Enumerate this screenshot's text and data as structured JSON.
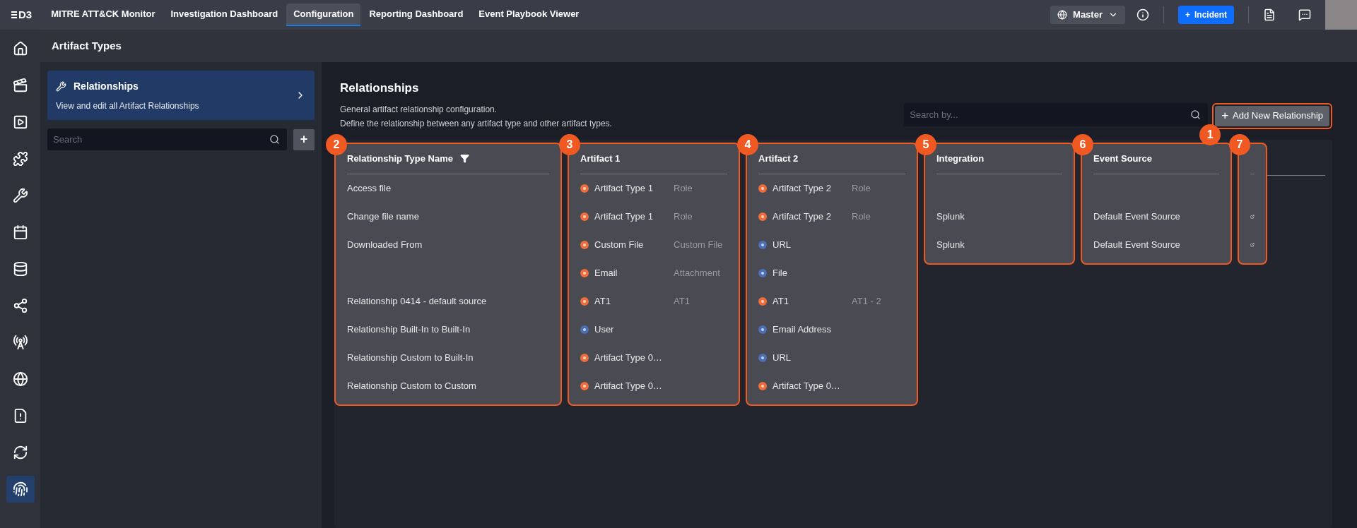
{
  "top_nav": {
    "logo": "D3",
    "tabs": [
      {
        "label": "MITRE ATT&CK Monitor",
        "selected": false
      },
      {
        "label": "Investigation Dashboard",
        "selected": false
      },
      {
        "label": "Configuration",
        "selected": true
      },
      {
        "label": "Reporting Dashboard",
        "selected": false
      },
      {
        "label": "Event Playbook Viewer",
        "selected": false
      }
    ],
    "site": "Master",
    "incident_button": "Incident",
    "incident_plus": "+"
  },
  "nav_rail": [
    {
      "selected": false
    },
    {
      "selected": false
    },
    {
      "selected": false
    },
    {
      "selected": false
    },
    {
      "selected": false
    },
    {
      "selected": false
    },
    {
      "selected": false
    },
    {
      "selected": false
    },
    {
      "selected": false
    },
    {
      "selected": false
    },
    {
      "selected": false
    },
    {
      "selected": false
    },
    {
      "selected": true
    }
  ],
  "page_title": "Artifact Types",
  "side_panel": {
    "card": {
      "title": "Relationships",
      "subtitle": "View and edit all Artifact Relationships"
    },
    "search": {
      "placeholder": "Search"
    },
    "add_button": "+"
  },
  "main": {
    "title": "Relationships",
    "description": [
      "General artifact relationship configuration.",
      "Define the relationship between any artifact type and other artifact types."
    ],
    "search": {
      "placeholder": "Search by..."
    },
    "add_button": {
      "plus": "+",
      "label": "Add New Relationship",
      "highlighted": true,
      "callout": "1"
    },
    "table": {
      "columns": [
        {
          "header": "Relationship Type Name",
          "filter": true,
          "highlighted": true,
          "callout": "2"
        },
        {
          "header": "Artifact 1",
          "highlighted": true,
          "callout": "3"
        },
        {
          "header": "Artifact 2",
          "highlighted": true,
          "callout": "4"
        },
        {
          "header": "Integration",
          "highlighted": true,
          "callout": "5"
        },
        {
          "header": "Event Source",
          "highlighted": true,
          "callout": "6"
        },
        {
          "highlighted": true,
          "callout": "7"
        }
      ],
      "rows": [
        {
          "name": "Access file",
          "artifact_1": {
            "name": "Artifact Type 1",
            "role": "Role",
            "color": "#ef6c3c"
          },
          "artifact_2": {
            "name": "Artifact Type 2",
            "role": "Role",
            "color": "#ef6c3c"
          }
        },
        {
          "name": "Change file name",
          "artifact_1": {
            "name": "Artifact Type 1",
            "role": "Role",
            "color": "#ef6c3c"
          },
          "artifact_2": {
            "name": "Artifact Type 2",
            "role": "Role",
            "color": "#ef6c3c"
          },
          "integration": "Splunk",
          "event_source": "Default Event Source",
          "link": true
        },
        {
          "name": "Downloaded From",
          "artifact_1": {
            "name": "Custom File",
            "role": "Custom File",
            "color": "#ef6c3c"
          },
          "artifact_2": {
            "name": "URL",
            "color": "#4a6fb5"
          },
          "integration": "Splunk",
          "event_source": "Default Event Source",
          "link": true
        },
        {
          "artifact_1": {
            "name": "Email",
            "role": "Attachment",
            "color": "#ef6c3c"
          },
          "artifact_2": {
            "name": "File",
            "color": "#4a6fb5"
          }
        },
        {
          "name": "Relationship 0414 - default source",
          "artifact_1": {
            "name": "AT1",
            "role": "AT1",
            "color": "#ef6c3c"
          },
          "artifact_2": {
            "name": "AT1",
            "role": "AT1 - 2",
            "color": "#ef6c3c"
          }
        },
        {
          "name": "Relationship Built-In to Built-In",
          "artifact_1": {
            "name": "User",
            "color": "#4a6fb5"
          },
          "artifact_2": {
            "name": "Email Address",
            "color": "#4a6fb5"
          }
        },
        {
          "name": "Relationship Custom to Built-In",
          "artifact_1": {
            "name": "Artifact Type 0…",
            "color": "#ef6c3c"
          },
          "artifact_2": {
            "name": "URL",
            "color": "#4a6fb5"
          }
        },
        {
          "name": "Relationship Custom to Custom",
          "artifact_1": {
            "name": "Artifact Type 0…",
            "color": "#ef6c3c"
          },
          "artifact_2": {
            "name": "Artifact Type 0…",
            "color": "#ef6c3c"
          }
        }
      ]
    }
  }
}
